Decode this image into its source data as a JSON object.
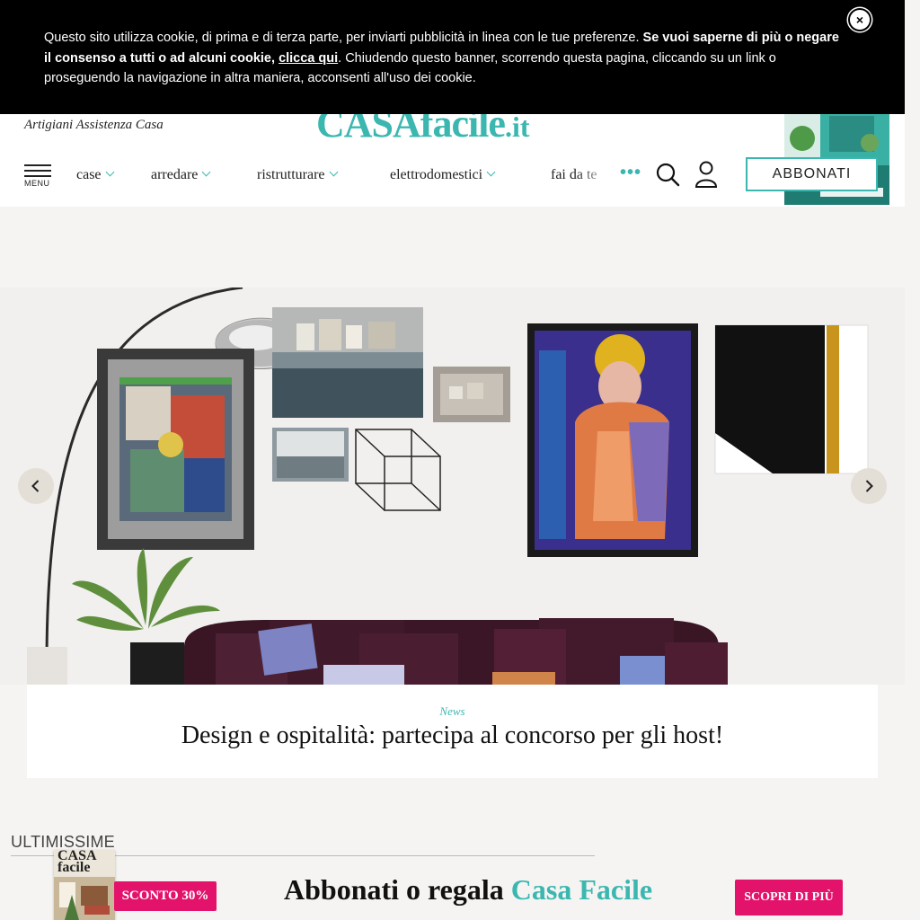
{
  "header": {
    "tagline": "Artigiani Assistenza Casa",
    "logo_main": "CASAfacile",
    "logo_suffix": ".it",
    "menu_label": "MENU",
    "nav_items": [
      {
        "label": "case"
      },
      {
        "label": "arredare"
      },
      {
        "label": "ristrutturare"
      },
      {
        "label": "elettrodomestici"
      },
      {
        "label": "fai da te"
      }
    ],
    "more_icon": "ellipsis-icon",
    "search_icon": "search-icon",
    "user_icon": "user-icon",
    "subscribe_label": "ABBONATI"
  },
  "cookie_banner": {
    "text_1": "Questo sito utilizza cookie, di prima e di terza parte, per inviarti pubblicità in linea con le tue preferenze. ",
    "text_bold": "Se vuoi saperne di più o negare il consenso a tutti o ad alcuni cookie, ",
    "link_label": "clicca qui",
    "text_2": ". Chiudendo questo banner, scorrendo questa pagina, cliccando su un link o proseguendo la navigazione in altra maniera, acconsenti all'uso dei cookie.",
    "close_label": "×"
  },
  "hero": {
    "category": "News",
    "title": "Design e ospitalità: partecipa al concorso per gli host!",
    "prev_icon": "chevron-left-icon",
    "next_icon": "chevron-right-icon"
  },
  "latest": {
    "section_title": "ULTIMISSIME"
  },
  "promo": {
    "cover_title": "CASA facile",
    "discount": "SCONTO 30%",
    "text_prefix": "Abbonati o regala ",
    "text_accent": "Casa Facile",
    "cta": "SCOPRI DI PIÙ"
  },
  "colors": {
    "accent": "#3bb7b0",
    "promo_pink": "#e3136c",
    "banner_bg": "#000000",
    "page_bg": "#f5f4f2"
  }
}
